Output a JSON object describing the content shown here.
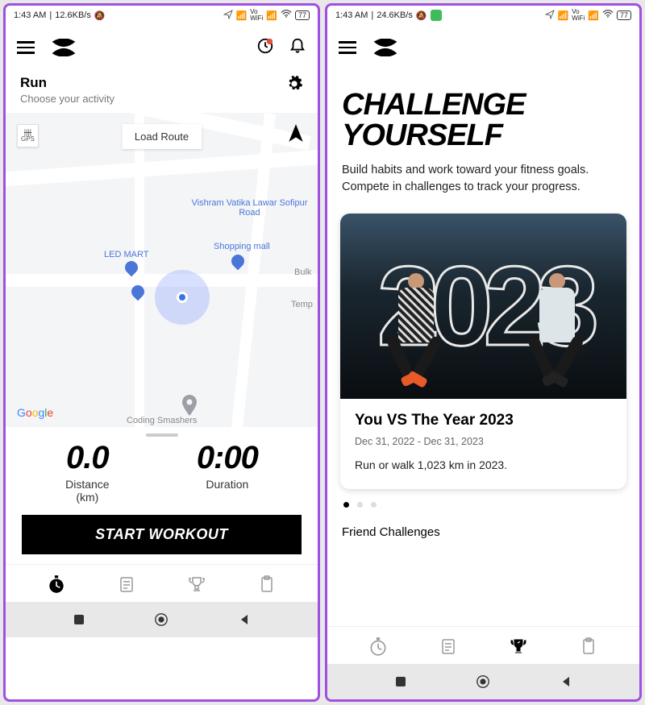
{
  "p1": {
    "status": {
      "time": "1:43 AM",
      "speed": "12.6KB/s",
      "battery": "77"
    },
    "header": {
      "title": "Run",
      "subtitle": "Choose your activity"
    },
    "map": {
      "gps": "GPS",
      "loadroute": "Load Route",
      "places": {
        "vishram": "Vishram Vatika Lawar Sofipur Road",
        "ledmart": "LED MART",
        "shopping": "Shopping mall",
        "bulk": "Bulk",
        "temp": "Temp",
        "coding": "Coding Smashers"
      },
      "google": "Google"
    },
    "stats": {
      "distance_val": "0.0",
      "distance_label": "Distance",
      "distance_unit": "(km)",
      "duration_val": "0:00",
      "duration_label": "Duration"
    },
    "start_button": "START WORKOUT"
  },
  "p2": {
    "status": {
      "time": "1:43 AM",
      "speed": "24.6KB/s",
      "battery": "77"
    },
    "headline": "CHALLENGE YOURSELF",
    "subhead": "Build habits and work toward your fitness goals. Compete in challenges to track your progress.",
    "card": {
      "year": "2023",
      "title": "You VS The Year 2023",
      "dates": "Dec 31, 2022 - Dec 31, 2023",
      "desc": "Run or walk 1,023 km in 2023."
    },
    "friend_section": "Friend Challenges"
  },
  "nav_icons": [
    "stopwatch",
    "log",
    "trophy",
    "clipboard"
  ]
}
